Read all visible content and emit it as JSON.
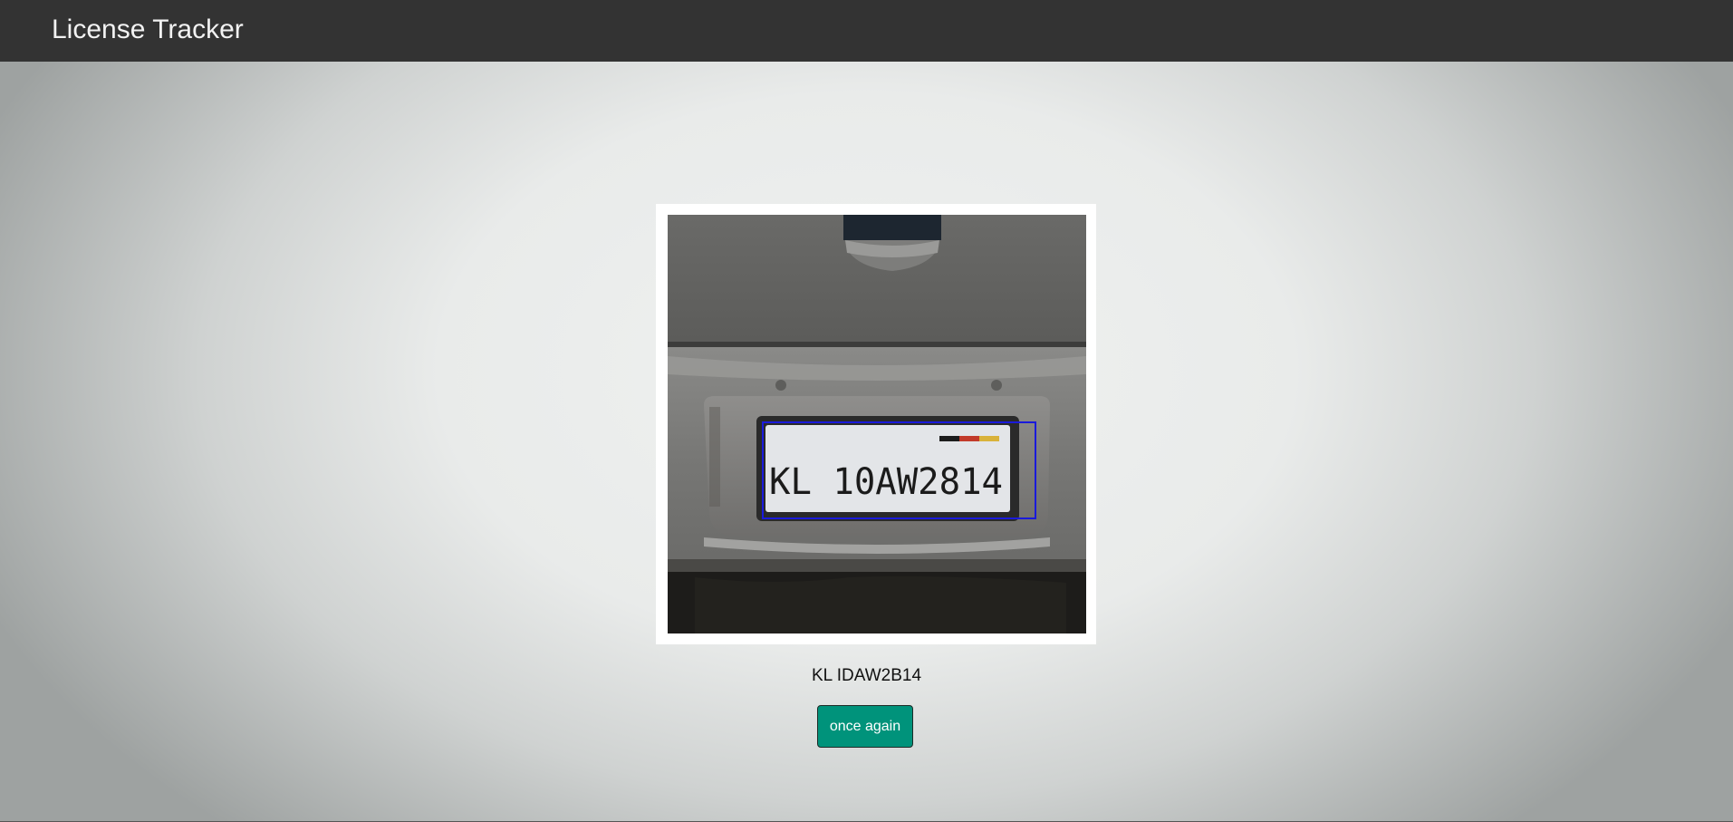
{
  "header": {
    "title": "License Tracker"
  },
  "result": {
    "image_alt": "car license plate detection",
    "plate_text_in_image": "KL 10AW2814",
    "recognized_text": "KL IDAW2B14",
    "button_label": "once again"
  },
  "colors": {
    "topbar": "#333333",
    "button": "#00937b",
    "detection_box": "#1a1adb"
  }
}
